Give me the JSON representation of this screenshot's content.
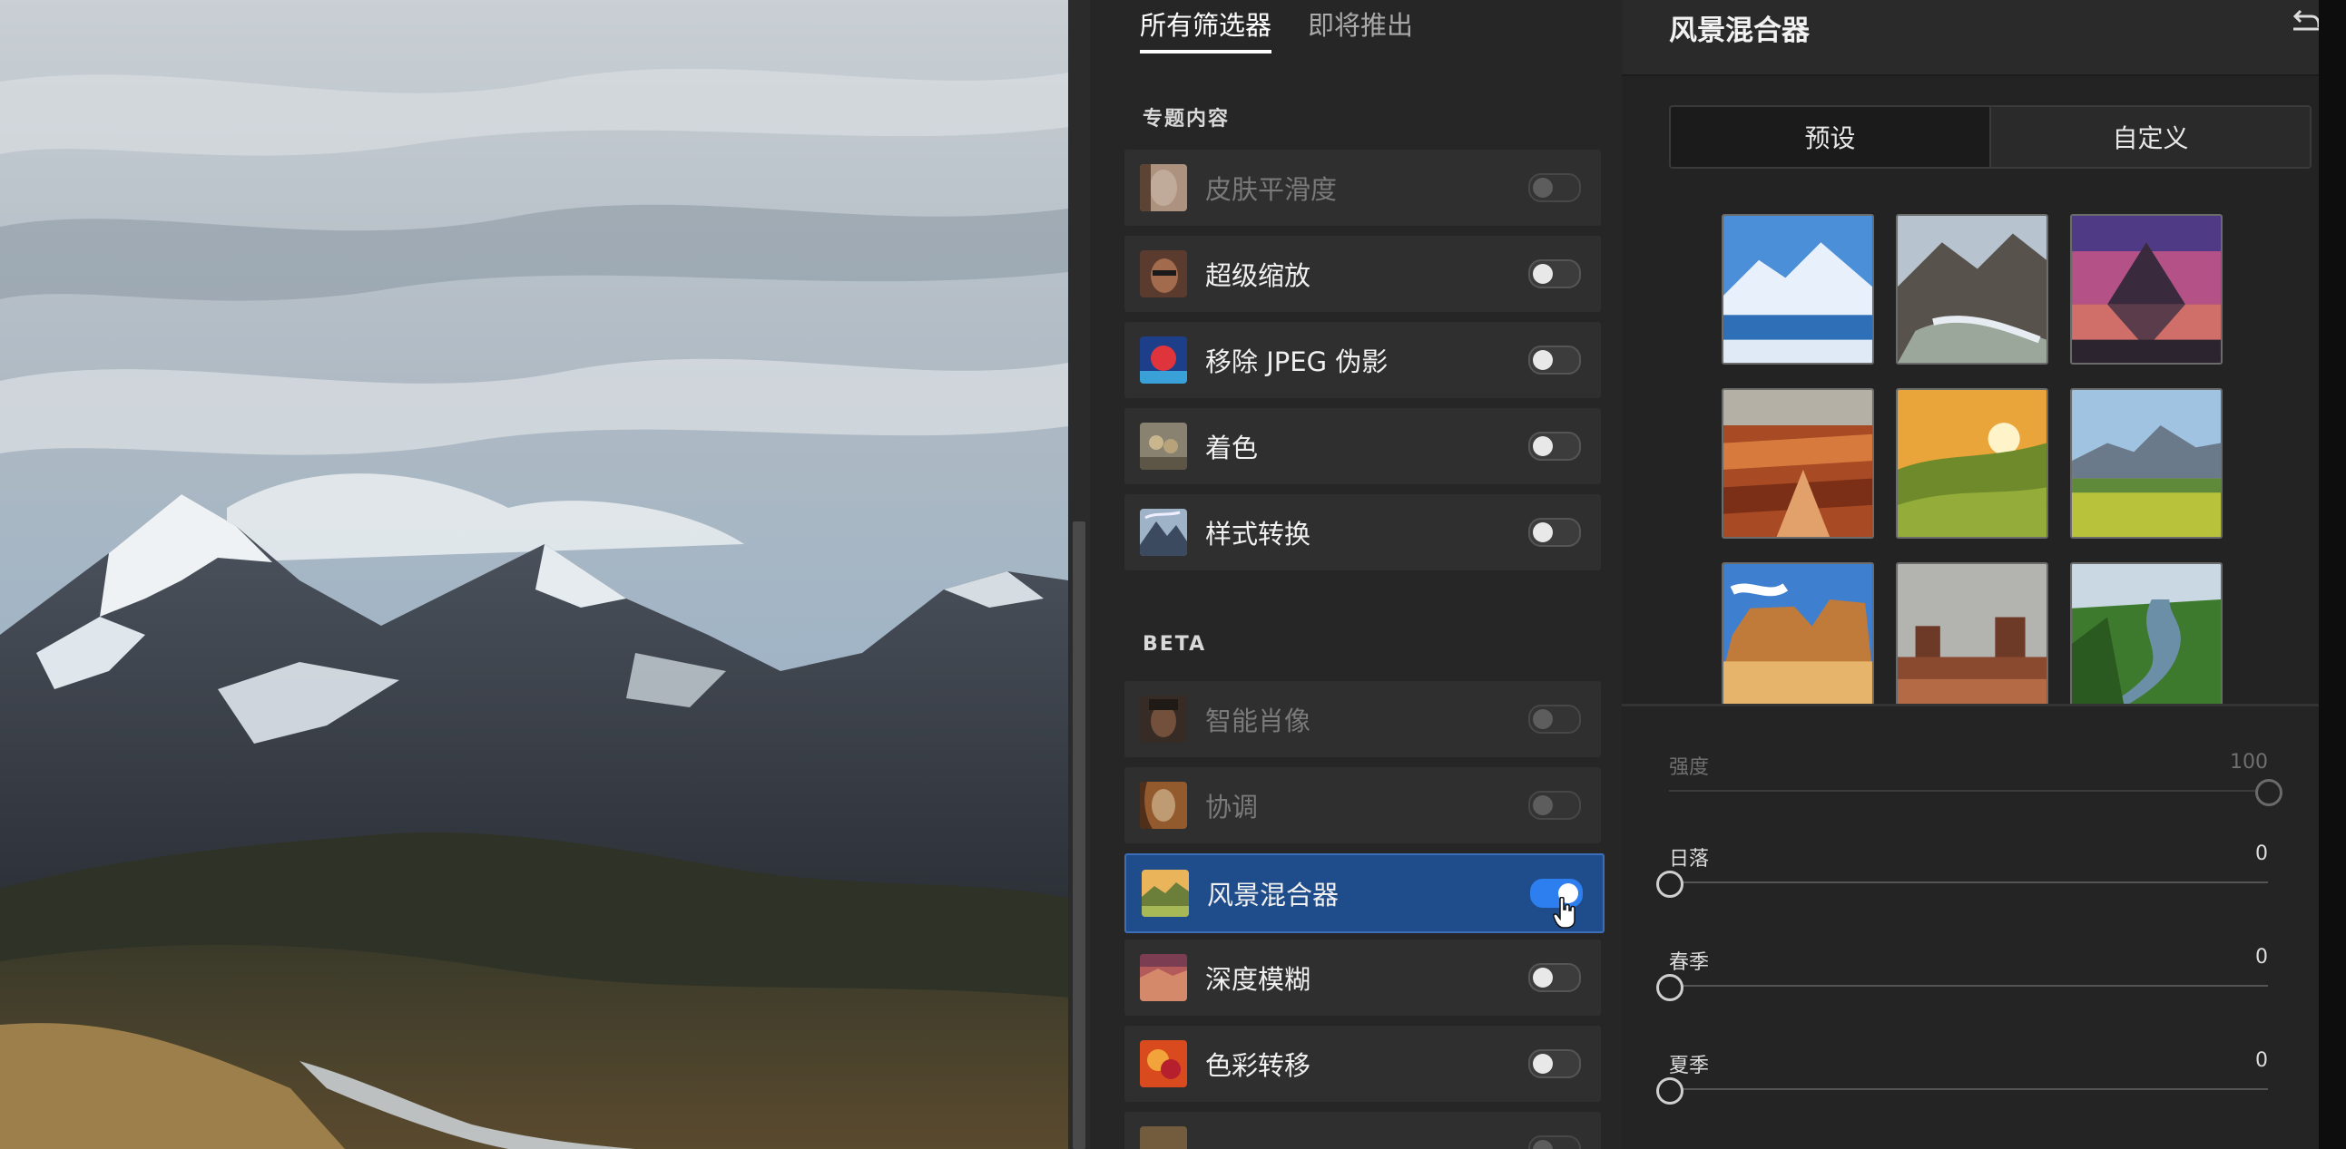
{
  "colors": {
    "accent": "#2d7ff0",
    "selected_row": "#1f4d8c",
    "panel": "#262626"
  },
  "filter_panel": {
    "tabs": [
      {
        "label": "所有筛选器",
        "active": true
      },
      {
        "label": "即将推出",
        "active": false
      }
    ],
    "sections": {
      "featured": "专题内容",
      "beta": "BETA"
    },
    "featured_items": [
      {
        "label": "皮肤平滑度",
        "enabled": false,
        "on": false
      },
      {
        "label": "超级缩放",
        "enabled": true,
        "on": false
      },
      {
        "label": "移除 JPEG 伪影",
        "enabled": true,
        "on": false
      },
      {
        "label": "着色",
        "enabled": true,
        "on": false
      },
      {
        "label": "样式转换",
        "enabled": true,
        "on": false
      }
    ],
    "beta_items": [
      {
        "label": "智能肖像",
        "enabled": false,
        "on": false
      },
      {
        "label": "协调",
        "enabled": false,
        "on": false
      },
      {
        "label": "风景混合器",
        "enabled": true,
        "on": true,
        "selected": true
      },
      {
        "label": "深度模糊",
        "enabled": true,
        "on": false
      },
      {
        "label": "色彩转移",
        "enabled": true,
        "on": false
      }
    ]
  },
  "mixer": {
    "title": "风景混合器",
    "segments": [
      {
        "label": "预设",
        "active": true
      },
      {
        "label": "自定义",
        "active": false
      }
    ],
    "presets": [
      "winter-lake",
      "mountain-valley",
      "sunset-peak",
      "canyon",
      "sunrise-hills",
      "spring-meadow",
      "desert-rocks",
      "monument-valley",
      "river-valley"
    ],
    "sliders": [
      {
        "label": "强度",
        "value": "100",
        "fraction": 1.0,
        "enabled": false
      },
      {
        "label": "日落",
        "value": "0",
        "fraction": 0.0,
        "enabled": true
      },
      {
        "label": "春季",
        "value": "0",
        "fraction": 0.0,
        "enabled": true
      },
      {
        "label": "夏季",
        "value": "0",
        "fraction": 0.0,
        "enabled": true
      }
    ]
  }
}
